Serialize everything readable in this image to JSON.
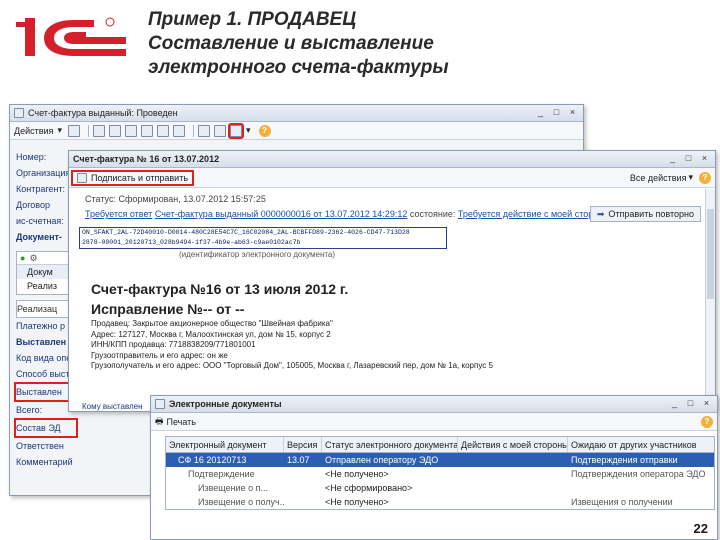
{
  "slide": {
    "title_lines": [
      "Пример 1. ПРОДАВЕЦ",
      "Составление и выставление",
      "электронного счета-фактуры"
    ],
    "page_number": "22",
    "logo_text": "1С"
  },
  "back_window": {
    "title": "Счет-фактура выданный: Проведен",
    "actions_label": "Действия",
    "form_labels": [
      "Номер:",
      "Организация:",
      "Контрагент:",
      "Договор",
      "ис-счетная:",
      "Документ-"
    ],
    "grid_labels": [
      "Докум",
      "Реализ"
    ],
    "lower_labels": [
      "Реализац",
      "Платежно р",
      "Выставлен",
      "Код вида опе",
      "Способ выст",
      "Выставлен",
      "Всего:",
      "Состав ЭД",
      "Ответствен",
      "Комментарий"
    ]
  },
  "invoice_window": {
    "title": "Счет-фактура № 16 от 13.07.2012",
    "sign_button": "Подписать и отправить",
    "all_actions": "Все действия",
    "status_line": "Статус: Сформирован, 13.07.2012 15:57:25",
    "req_prefix": "Требуется ответ",
    "req_link": "Счет-фактура выданный 0000000016 от 13.07.2012 14:29:12",
    "state_label": "состояние:",
    "state_link": "Требуется действие с моей стороны",
    "resend_button": "Отправить повторно",
    "id_line1": "ON_SFAKT_2AL-72D40010-D0014-480C28E54C7C_16C02084_2AL-BCBFFD89-2362-4026-CD47-713D28",
    "id_line2": "2878-00001_20120713_028b9494-1f37-4b9e-ab63-c9ae0102ac7b",
    "id_line3": "(идентификатор электронного документа)",
    "doc_title1": "Счет-фактура №16 от 13 июля 2012 г.",
    "doc_title2": "Исправление №-- от --",
    "details": [
      "Продавец: Закрытое акционерное общество \"Швейная фабрика\"",
      "Адрес: 127127, Москва г, Малоохтинская ул, дом № 15, корпус 2",
      "ИНН/КПП продавца: 7718838209/771801001",
      "Грузоотправитель и его адрес: он же",
      "Грузополучатель и его адрес: ООО \"Торговый Дом\", 105005, Москва г, Лазаревский пер, дом № 1а, корпус 5"
    ],
    "side_peek": "Комментарий"
  },
  "edoc_window": {
    "title": "Электронные документы",
    "print_label": "Печать",
    "columns": [
      "Электронный документ",
      "Версия",
      "Статус электронного документа",
      "Действия с моей стороны",
      "Ожидаю от других участников"
    ],
    "rows": [
      {
        "doc": "СФ 16 20120713",
        "ver": "13.07",
        "status": "Отправлен оператору ЭДО",
        "action": "",
        "wait": "Подтверждения отправки",
        "selected": true
      },
      {
        "doc": "Подтверждение",
        "ver": "",
        "status": "<Не получено>",
        "action": "",
        "wait": "Подтверждения оператора ЭДО",
        "selected": false
      },
      {
        "doc": "Извещение о п...",
        "ver": "",
        "status": "<Не сформировано>",
        "action": "",
        "wait": "",
        "selected": false
      },
      {
        "doc": "Извещение о получ...",
        "ver": "",
        "status": "<Не получено>",
        "action": "",
        "wait": "Извещения о получении",
        "selected": false
      }
    ],
    "bottom_left": "Кому выставлен"
  }
}
